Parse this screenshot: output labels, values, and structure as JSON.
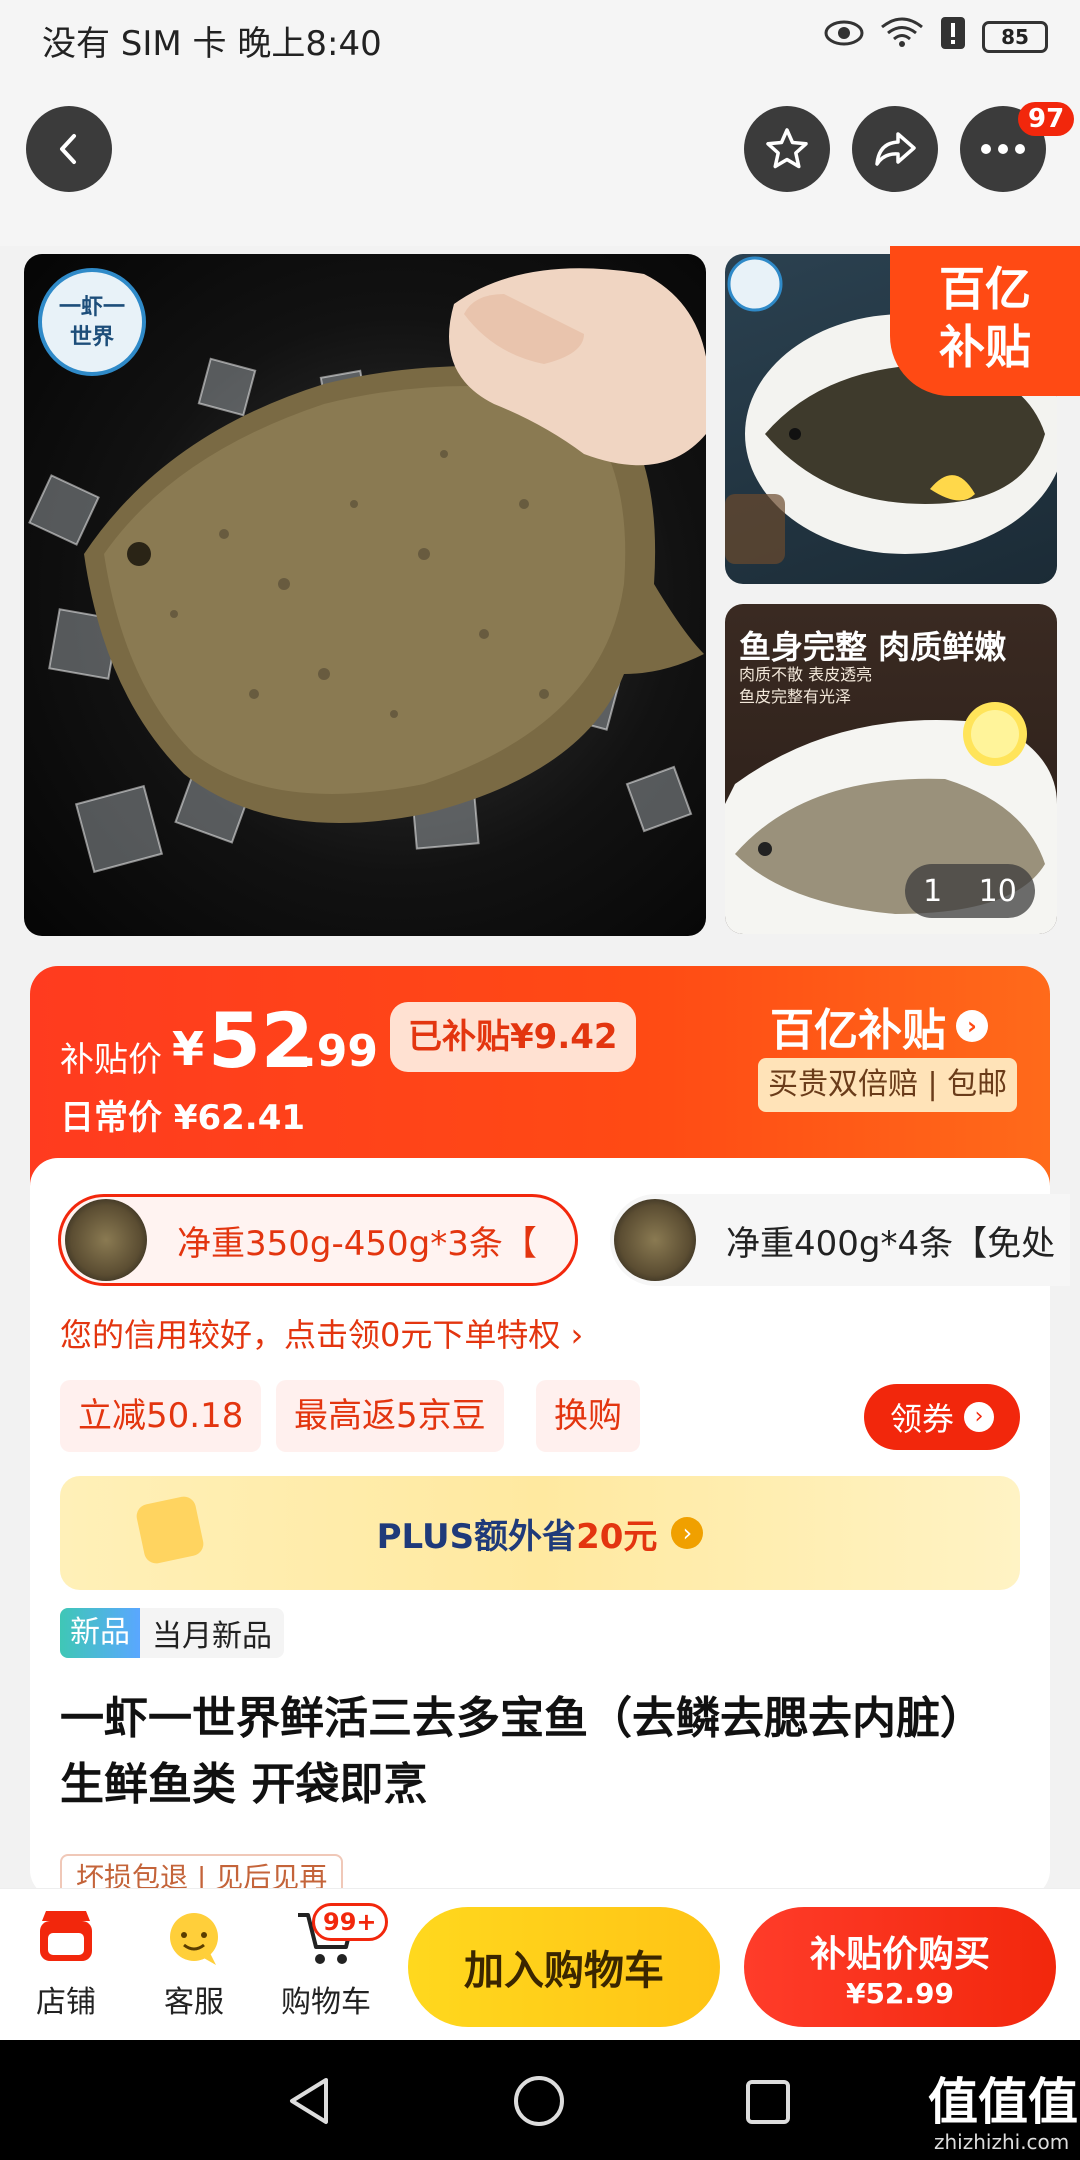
{
  "status": {
    "carrier": "没有 SIM 卡 晚上8:40",
    "battery": "85"
  },
  "header": {
    "more_badge": "97"
  },
  "gallery": {
    "logo_text": "一虾一世界",
    "subsidy_tag": [
      "百亿",
      "补贴"
    ],
    "side2_caption": "鱼身完整 肉质鲜嫩",
    "side2_sub": "肉质不散 表皮透亮\n鱼皮完整有光泽",
    "page_indicator": {
      "current": "1",
      "total": "10"
    }
  },
  "price": {
    "label": "补贴价",
    "currency": "¥",
    "integer": "52",
    "decimal": ".99",
    "subsidized_badge": "已补贴¥9.42",
    "regular": "日常价 ¥62.41",
    "brand": "百亿补贴",
    "brand_sub": "买贵双倍赔 | 包邮"
  },
  "skus": [
    {
      "label": "净重350g-450g*3条【"
    },
    {
      "label": "净重400g*4条【免处"
    }
  ],
  "credit_notice": "您的信用较好，点击领0元下单特权 ›",
  "promos": [
    "立减50.18",
    "最高返5京豆",
    "换购"
  ],
  "coupon_btn": "领券",
  "plus_banner": {
    "prefix": "PLUS额外省",
    "amount": "20元"
  },
  "tags": {
    "new": "新品",
    "new_label": "当月新品"
  },
  "title": "一虾一世界鲜活三去多宝鱼（去鳞去腮去内脏）生鲜鱼类 开袋即烹",
  "service_tags_partial": "坏损包退 | 见后见再",
  "bottom": {
    "store": "店铺",
    "service": "客服",
    "cart": "购物车",
    "cart_badge": "99+",
    "add_to_cart": "加入购物车",
    "buy_label": "补贴价购买",
    "buy_price": "¥52.99"
  },
  "watermark": "值值值",
  "watermark_url": "zhizhizhi.com",
  "colors": {
    "accent": "#f2270c",
    "orange": "#ff4a14",
    "yellow": "#ffd21e"
  }
}
